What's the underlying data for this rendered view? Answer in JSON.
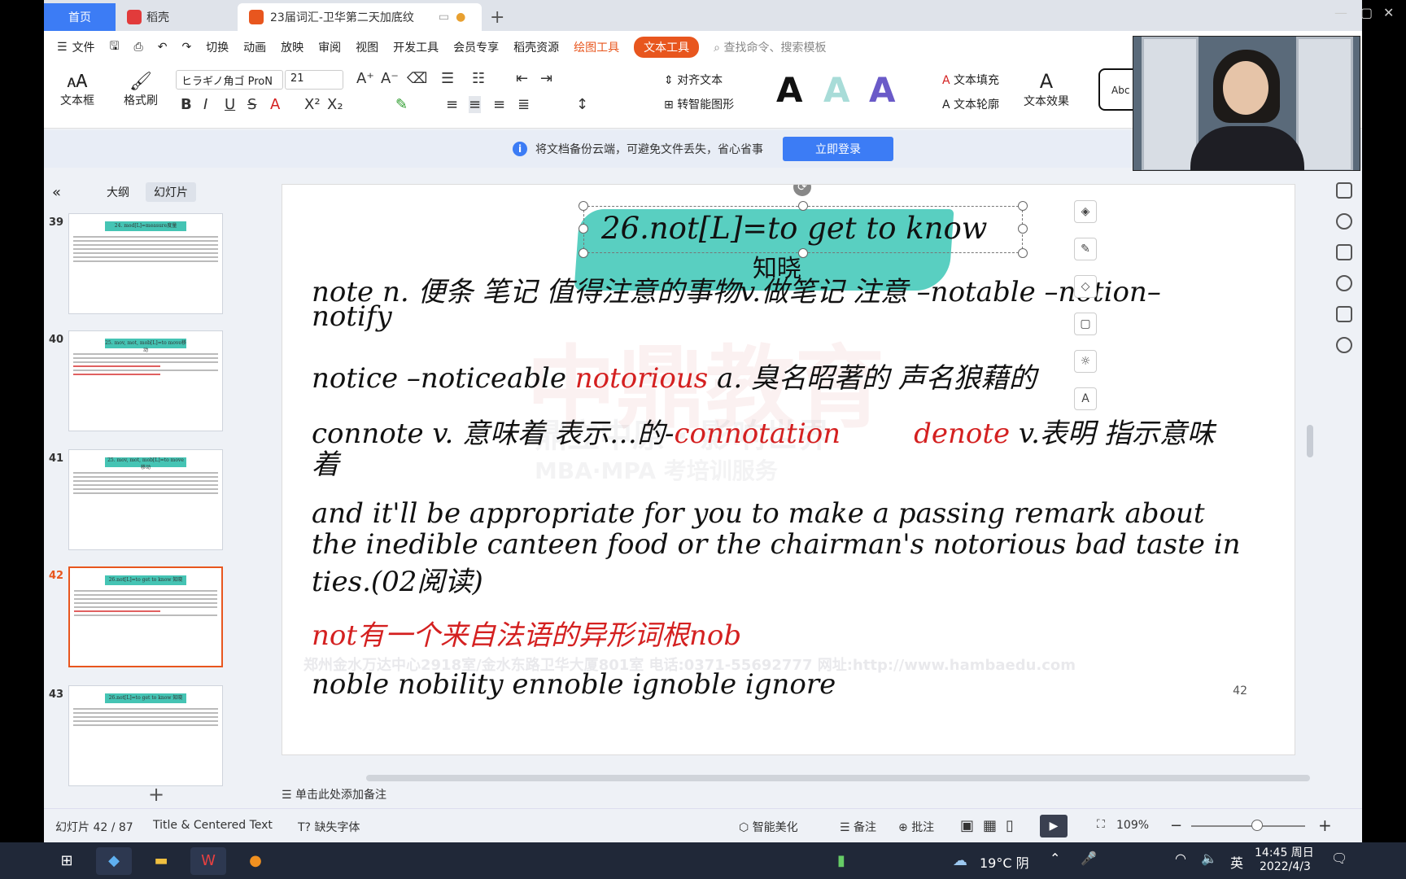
{
  "tabs": {
    "home": "首页",
    "daoke": "稻壳",
    "document": "23届词汇-卫华第二天加底纹"
  },
  "menu": {
    "file": "文件",
    "items": [
      "切换",
      "动画",
      "放映",
      "审阅",
      "视图",
      "开发工具",
      "会员专享",
      "稻壳资源"
    ],
    "draw_tools": "绘图工具",
    "text_tools": "文本工具",
    "search_placeholder": "查找命令、搜索模板"
  },
  "ribbon": {
    "textbox": "文本框",
    "format_painter": "格式刷",
    "font_name": "ヒラギノ角ゴ ProN",
    "font_size": "21",
    "align_text": "对齐文本",
    "smart_shape": "转智能图形",
    "text_fill": "文本填充",
    "text_outline": "文本轮廓",
    "text_effect": "文本效果",
    "style_preview": "Abc"
  },
  "notice": {
    "message": "将文档备份云端，可避免文件丢失，省心省事",
    "login": "立即登录"
  },
  "left_panel": {
    "outline": "大纲",
    "slides": "幻灯片",
    "thumbnails": [
      {
        "num": "39",
        "title": "24. mod[L]=measure度量"
      },
      {
        "num": "40",
        "title": "25. mov, mot, mob[L]=to move移动"
      },
      {
        "num": "41",
        "title": "25. mov, mot, mob[L]=to move 移动"
      },
      {
        "num": "42",
        "title": "26.not[L]=to get to know 知晓"
      },
      {
        "num": "43",
        "title": "26.not[L]=to get to know 知晓"
      }
    ]
  },
  "slide": {
    "title": "26.not[L]=to get to know",
    "title_cn": "知晓",
    "line1a": "note n. 便条 笔记 值得注意的事物v.做笔记 注意 –notable –notion–",
    "line1b": "notify",
    "line2_pre": "notice –noticeable ",
    "line2_red": "notorious",
    "line2_post": " a. 臭名昭著的 声名狼藉的",
    "line3_pre": "connote v. 意味着 表示…的-",
    "line3_red1": "connotation",
    "line3_red2": "denote",
    "line3_post": " v.表明 指示意味",
    "line3b": "着",
    "line4a": "and it'll be appropriate for you to make a passing remark about",
    "line4b": "the inedible canteen food or the chairman's notorious bad taste in",
    "line4c": "ties.(02阅读)",
    "line5": "not有一个来自法语的异形词根nob",
    "line6": "noble   nobility ennoble ignoble     ignore",
    "watermark_big": "中鼎教育",
    "watermark_mid": "鼎立中原 · 影响世界",
    "watermark_small": "MBA·MPA 考培训服务",
    "watermark_addr": "郑州金水万达中心2918室/金水东路卫华大厦801室  电话:0371-55692777  网址:http://www.hambaedu.com",
    "page_num": "42"
  },
  "notes_placeholder": "单击此处添加备注",
  "status": {
    "slide_counter": "幻灯片 42 / 87",
    "layout": "Title & Centered Text",
    "missing_font": "缺失字体",
    "beautify": "智能美化",
    "notes": "备注",
    "comment": "批注",
    "zoom": "109%"
  },
  "taskbar": {
    "weather": "19°C 阴",
    "ime": "英",
    "time": "14:45 周日",
    "date": "2022/4/3"
  },
  "colors": {
    "accent_blue": "#3c7cf5",
    "accent_orange": "#e8561e",
    "title_band": "#3cc7b6",
    "red_text": "#d42020"
  }
}
